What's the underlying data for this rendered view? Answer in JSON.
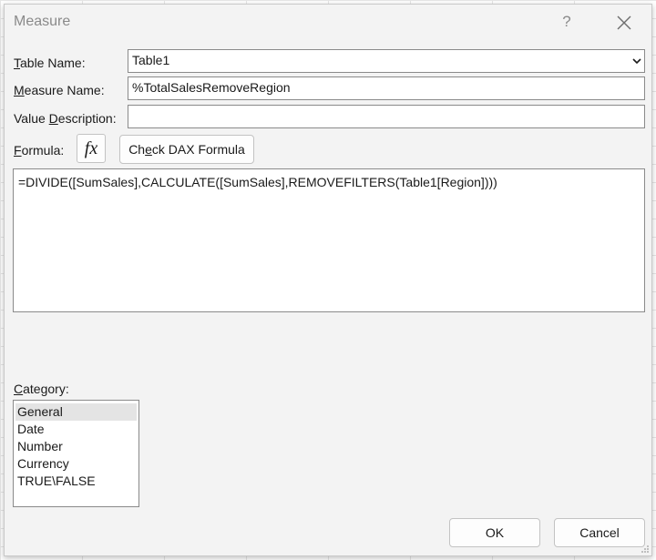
{
  "dialog": {
    "title": "Measure",
    "help_glyph": "?"
  },
  "table_name": {
    "label_underline": "T",
    "label_rest": "able Name:",
    "value": "Table1"
  },
  "measure_name": {
    "label_underline": "M",
    "label_rest": "easure Name:",
    "value": "%TotalSalesRemoveRegion"
  },
  "value_description": {
    "label_pre": "Value ",
    "label_underline": "D",
    "label_rest": "escription:",
    "value": ""
  },
  "formula": {
    "label_underline": "F",
    "label_rest": "ormula:",
    "fx_label": "fx",
    "check_label_pre": "Ch",
    "check_label_underline": "e",
    "check_label_rest": "ck DAX Formula",
    "text": "=DIVIDE([SumSales],CALCULATE([SumSales],REMOVEFILTERS(Table1[Region])))"
  },
  "category": {
    "label_underline": "C",
    "label_rest": "ategory:",
    "items": [
      "General",
      "Date",
      "Number",
      "Currency",
      "TRUE\\FALSE"
    ],
    "selected": "General"
  },
  "buttons": {
    "ok": "OK",
    "cancel": "Cancel"
  },
  "icons": {
    "close": "close-icon",
    "dropdown": "chevron-down-icon",
    "resize": "resize-grip-icon"
  }
}
